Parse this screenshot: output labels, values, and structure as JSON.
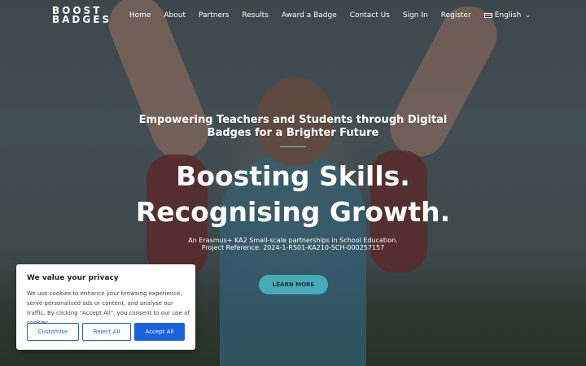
{
  "brand": {
    "line1": "BOOST",
    "line2": "BADGES"
  },
  "nav": {
    "items": [
      "Home",
      "About",
      "Partners",
      "Results",
      "Award a Badge",
      "Contact Us",
      "Sign In",
      "Register"
    ],
    "language": "English",
    "language_flag_icon": "uk-flag-icon",
    "chevron_icon": "chevron-down-icon"
  },
  "hero": {
    "tagline": "Empowering Teachers and Students through Digital Badges for a Brighter Future",
    "headline_line1": "Boosting Skills.",
    "headline_line2": "Recognising Growth.",
    "sub_line1": "An Erasmus+ KA2 Small-scale partnerships in School Education.",
    "sub_line2": "Project Reference: 2024-1-RS01-KA210-SCH-000257157",
    "cta_label": "LEARN MORE",
    "accent_color": "#46aab7"
  },
  "cookie_banner": {
    "title": "We value your privacy",
    "text": "We use cookies to enhance your browsing experience, serve personalised ads or content, and analyse our traffic. By clicking \"Accept All\", you consent to our use of cookies.",
    "customise_label": "Customise",
    "reject_label": "Reject All",
    "accept_label": "Accept All",
    "button_color": "#1863dc"
  }
}
